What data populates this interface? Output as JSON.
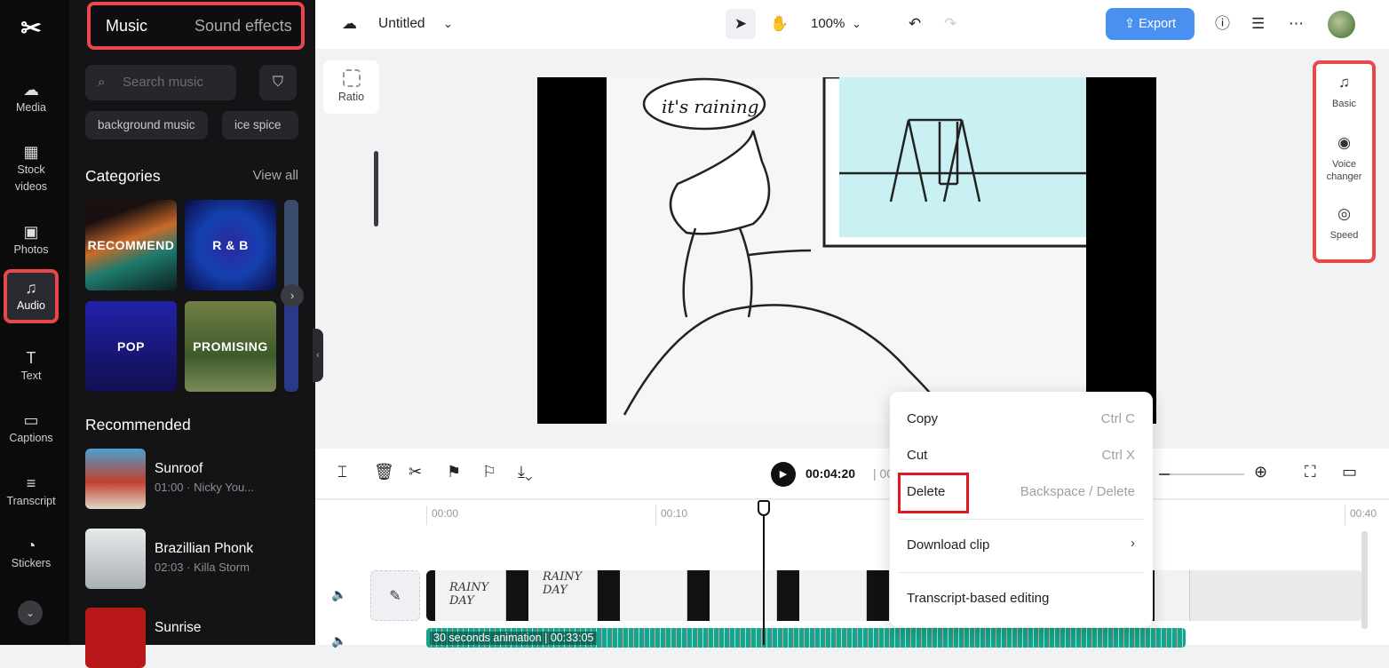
{
  "app": {
    "title": "Untitled",
    "zoom": "100%",
    "export_label": "Export"
  },
  "rail": {
    "items": [
      {
        "label": "Media",
        "icon": "cloud-upload-icon"
      },
      {
        "label": "Stock videos",
        "icon": "film-icon"
      },
      {
        "label": "Photos",
        "icon": "image-icon"
      },
      {
        "label": "Audio",
        "icon": "music-icon",
        "active": true
      },
      {
        "label": "Text",
        "icon": "text-icon"
      },
      {
        "label": "Captions",
        "icon": "captions-icon"
      },
      {
        "label": "Transcript",
        "icon": "transcript-icon"
      },
      {
        "label": "Stickers",
        "icon": "sticker-icon"
      }
    ]
  },
  "panel": {
    "tabs": [
      "Music",
      "Sound effects"
    ],
    "search_placeholder": "Search music",
    "chips": [
      "background music",
      "ice spice"
    ],
    "categories_title": "Categories",
    "view_all": "View all",
    "categories": [
      "RECOMMEND",
      "R & B",
      "POP",
      "PROMISING"
    ],
    "recommended_title": "Recommended",
    "tracks": [
      {
        "name": "Sunroof",
        "meta": "01:00 · Nicky You..."
      },
      {
        "name": "Brazillian Phonk",
        "meta": "02:03 · Killa Storm"
      },
      {
        "name": "Sunrise",
        "meta": ""
      }
    ]
  },
  "canvas": {
    "ratio_label": "Ratio",
    "speech": "it's raining"
  },
  "right_panel": [
    {
      "label": "Basic",
      "icon": "music-note-icon"
    },
    {
      "label": "Voice changer",
      "icon": "voice-icon"
    },
    {
      "label": "Speed",
      "icon": "speedometer-icon"
    }
  ],
  "timeline": {
    "current_time": "00:04:20",
    "total_prefix": "| 00",
    "ruler": [
      "00:00",
      "00:10",
      "00:40"
    ],
    "video_frame_text": [
      "RAINY DAY",
      "RAINY DAY"
    ],
    "audio_label": "30 seconds animation",
    "audio_duration": "00:33:05"
  },
  "context_menu": {
    "items": [
      {
        "label": "Copy",
        "shortcut": "Ctrl C"
      },
      {
        "label": "Cut",
        "shortcut": "Ctrl X"
      },
      {
        "label": "Delete",
        "shortcut": "Backspace / Delete"
      },
      {
        "label": "Download clip",
        "shortcut": ""
      },
      {
        "label": "Transcript-based editing",
        "shortcut": ""
      }
    ]
  },
  "colors": {
    "highlight": "#e9474a",
    "accent": "#4a90f0",
    "audio_track": "#13a58f"
  }
}
